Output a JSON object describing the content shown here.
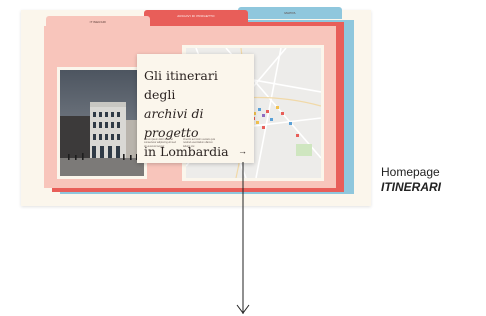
{
  "mockup": {
    "tabs": [
      {
        "label": "ITINERARI"
      },
      {
        "label": "ARCHIVI DI PROGETTO"
      },
      {
        "label": "MAPPA"
      }
    ],
    "card": {
      "title_part1": "Gli itinerari degli",
      "title_part2": "archivi di progetto",
      "title_part3": "in Lombardia",
      "blurb_left": "Lorem ipsum dolor sit amet consectetur adipiscing elit sed do eiusmod tempor",
      "blurb_right": "Ut enim ad minim veniam quis nostrud exercitation ullamco laboris nisi",
      "arrow": "→"
    }
  },
  "caption": {
    "line1": "Homepage",
    "line2": "ITINERARI"
  },
  "colors": {
    "background": "#fbf6ec",
    "pink": "#f8c5bb",
    "red": "#e85e59",
    "blue": "#8fc7dd"
  },
  "icons": {
    "card_arrow": "arrow-right-icon",
    "flow_arrow": "arrow-down-icon"
  }
}
